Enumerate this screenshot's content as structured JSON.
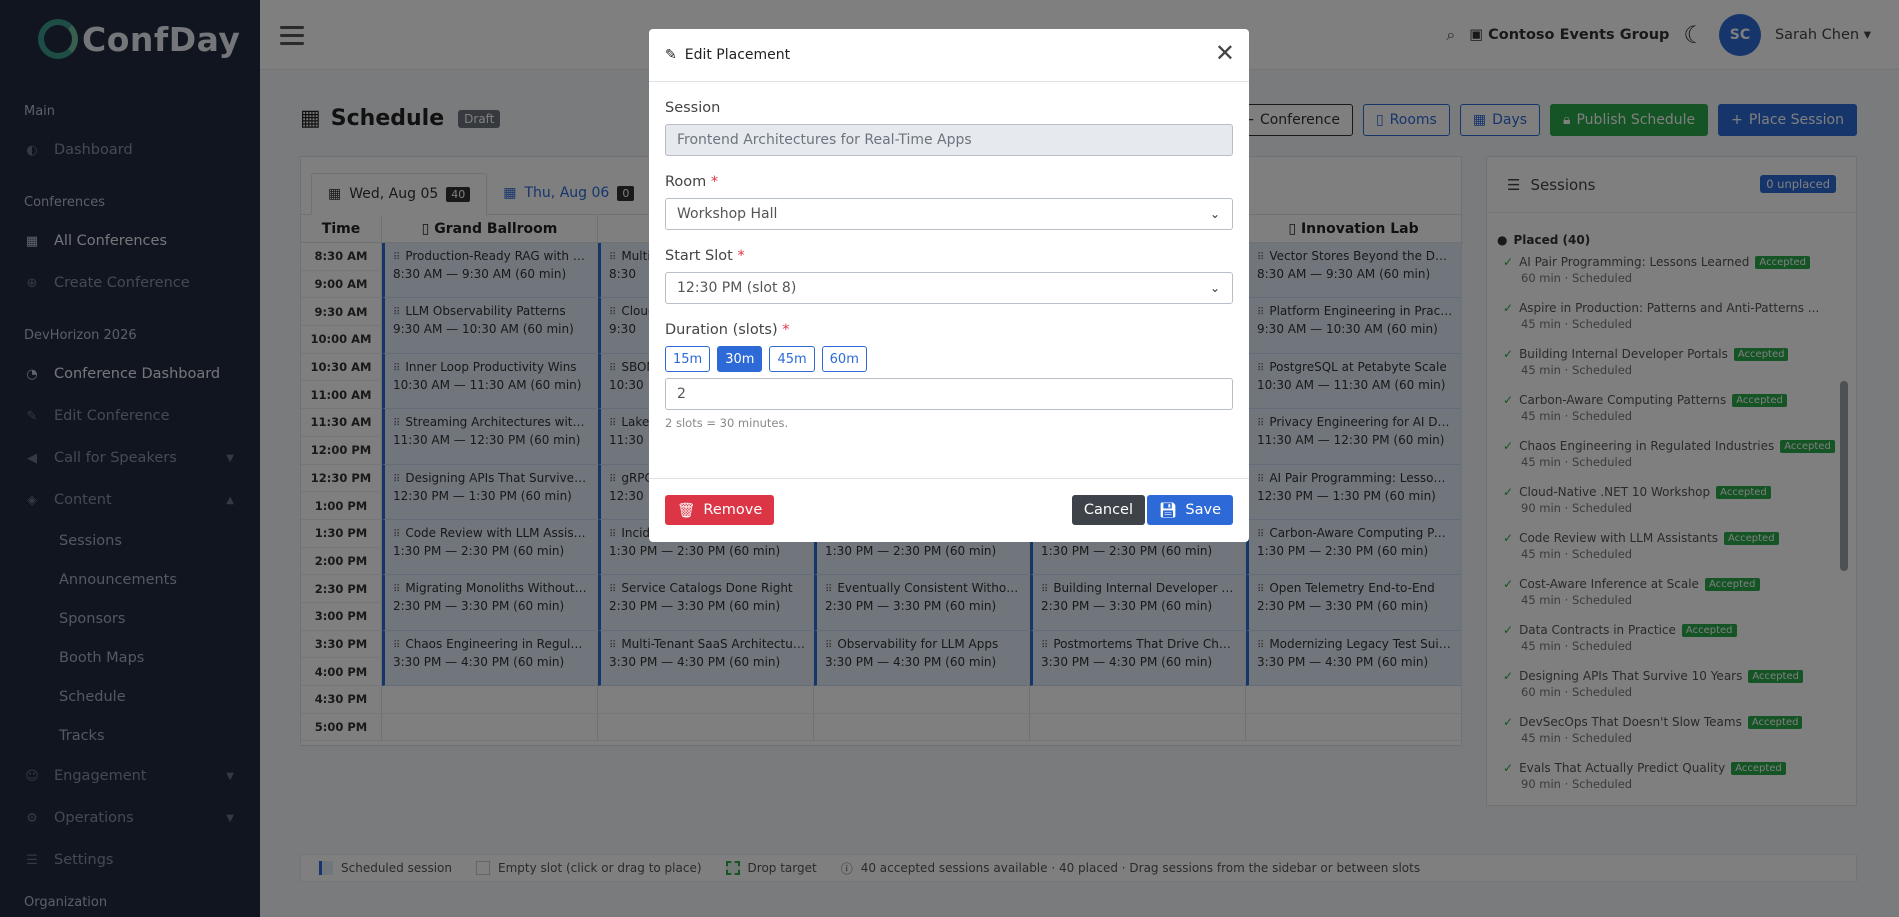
{
  "brand": {
    "name": "ConfDay"
  },
  "sidebar": {
    "sections": {
      "main": "Main",
      "conferences": "Conferences",
      "event": "DevHorizon 2026",
      "organization": "Organization"
    },
    "items": {
      "dashboard": "Dashboard",
      "all_conferences": "All Conferences",
      "create_conference": "Create Conference",
      "conference_dashboard": "Conference Dashboard",
      "edit_conference": "Edit Conference",
      "call_for_speakers": "Call for Speakers",
      "content": "Content",
      "engagement": "Engagement",
      "operations": "Operations",
      "settings": "Settings"
    },
    "content_sub": [
      "Sessions",
      "Announcements",
      "Sponsors",
      "Booth Maps",
      "Schedule",
      "Tracks"
    ]
  },
  "topbar": {
    "org": "Contoso Events Group",
    "avatar_initials": "SC",
    "user_name": "Sarah Chen"
  },
  "page": {
    "title": "Schedule",
    "status_badge": "Draft",
    "buttons": {
      "conference": "Conference",
      "rooms": "Rooms",
      "days": "Days",
      "publish": "Publish Schedule",
      "place": "Place Session"
    }
  },
  "day_tabs": [
    {
      "label": "Wed, Aug 05",
      "count": "40"
    },
    {
      "label": "Thu, Aug 06",
      "count": "0"
    }
  ],
  "grid": {
    "time_header": "Time",
    "rooms": [
      "Grand Ballroom",
      "",
      "",
      "",
      "Innovation Lab"
    ],
    "times": [
      "8:30 AM",
      "9:00 AM",
      "9:30 AM",
      "10:00 AM",
      "10:30 AM",
      "11:00 AM",
      "11:30 AM",
      "12:00 PM",
      "12:30 PM",
      "1:00 PM",
      "1:30 PM",
      "2:00 PM",
      "2:30 PM",
      "3:00 PM",
      "3:30 PM",
      "4:00 PM",
      "4:30 PM",
      "5:00 PM"
    ],
    "sessions": [
      {
        "col": 0,
        "row": 0,
        "title": "Production-Ready RAG with Ope...",
        "time": "8:30 AM — 9:30 AM (60 min)"
      },
      {
        "col": 0,
        "row": 2,
        "title": "LLM Observability Patterns",
        "time": "9:30 AM — 10:30 AM (60 min)"
      },
      {
        "col": 0,
        "row": 4,
        "title": "Inner Loop Productivity Wins",
        "time": "10:30 AM — 11:30 AM (60 min)"
      },
      {
        "col": 0,
        "row": 6,
        "title": "Streaming Architectures with Kaf...",
        "time": "11:30 AM — 12:30 PM (60 min)"
      },
      {
        "col": 0,
        "row": 8,
        "title": "Designing APIs That Survive 10 Ye...",
        "time": "12:30 PM — 1:30 PM (60 min)"
      },
      {
        "col": 0,
        "row": 10,
        "title": "Code Review with LLM Assistants",
        "time": "1:30 PM — 2:30 PM (60 min)"
      },
      {
        "col": 0,
        "row": 12,
        "title": "Migrating Monoliths Without Tears",
        "time": "2:30 PM — 3:30 PM (60 min)"
      },
      {
        "col": 0,
        "row": 14,
        "title": "Chaos Engineering in Regulated ...",
        "time": "3:30 PM — 4:30 PM (60 min)"
      },
      {
        "col": 1,
        "row": 0,
        "title": "Multi-",
        "time": "8:30"
      },
      {
        "col": 1,
        "row": 2,
        "title": "Cloud",
        "time": "9:30"
      },
      {
        "col": 1,
        "row": 4,
        "title": "SBOM",
        "time": "10:30"
      },
      {
        "col": 1,
        "row": 6,
        "title": "Lakeh",
        "time": "11:30"
      },
      {
        "col": 1,
        "row": 8,
        "title": "gRPC",
        "time": "12:30"
      },
      {
        "col": 1,
        "row": 10,
        "title": "Incid",
        "time": "1:30 PM — 2:30 PM (60 min)"
      },
      {
        "col": 1,
        "row": 12,
        "title": "Service Catalogs Done Right",
        "time": "2:30 PM — 3:30 PM (60 min)"
      },
      {
        "col": 1,
        "row": 14,
        "title": "Multi-Tenant SaaS Architectures",
        "time": "3:30 PM — 4:30 PM (60 min)"
      },
      {
        "col": 2,
        "row": 10,
        "title": "",
        "time": "1:30 PM — 2:30 PM (60 min)"
      },
      {
        "col": 2,
        "row": 12,
        "title": "Eventually Consistent Without th...",
        "time": "2:30 PM — 3:30 PM (60 min)"
      },
      {
        "col": 2,
        "row": 14,
        "title": "Observability for LLM Apps",
        "time": "3:30 PM — 4:30 PM (60 min)"
      },
      {
        "col": 3,
        "row": 10,
        "title": "",
        "time": "1:30 PM — 2:30 PM (60 min)"
      },
      {
        "col": 3,
        "row": 12,
        "title": "Building Internal Developer Porta...",
        "time": "2:30 PM — 3:30 PM (60 min)"
      },
      {
        "col": 3,
        "row": 14,
        "title": "Postmortems That Drive Change",
        "time": "3:30 PM — 4:30 PM (60 min)"
      },
      {
        "col": 4,
        "row": 0,
        "title": "Vector Stores Beyond the Demo",
        "time": "8:30 AM — 9:30 AM (60 min)"
      },
      {
        "col": 4,
        "row": 2,
        "title": "Platform Engineering in Practice",
        "time": "9:30 AM — 10:30 AM (60 min)"
      },
      {
        "col": 4,
        "row": 4,
        "title": "PostgreSQL at Petabyte Scale",
        "time": "10:30 AM — 11:30 AM (60 min)"
      },
      {
        "col": 4,
        "row": 6,
        "title": "Privacy Engineering for AI Datase...",
        "time": "11:30 AM — 12:30 PM (60 min)"
      },
      {
        "col": 4,
        "row": 8,
        "title": "AI Pair Programming: Lessons Le...",
        "time": "12:30 PM — 1:30 PM (60 min)"
      },
      {
        "col": 4,
        "row": 10,
        "title": "Carbon-Aware Computing Patte...",
        "time": "1:30 PM — 2:30 PM (60 min)"
      },
      {
        "col": 4,
        "row": 12,
        "title": "Open Telemetry End-to-End",
        "time": "2:30 PM — 3:30 PM (60 min)"
      },
      {
        "col": 4,
        "row": 14,
        "title": "Modernizing Legacy Test Suites",
        "time": "3:30 PM — 4:30 PM (60 min)"
      }
    ]
  },
  "sessions_panel": {
    "title": "Sessions",
    "unplaced_badge": "0 unplaced",
    "placed_header": "Placed (40)",
    "items": [
      {
        "title": "AI Pair Programming: Lessons Learned",
        "badge": "Accepted",
        "meta": "60 min · Scheduled"
      },
      {
        "title": "Aspire in Production: Patterns and Anti-Patterns ...",
        "badge": "",
        "meta": "45 min · Scheduled"
      },
      {
        "title": "Building Internal Developer Portals",
        "badge": "Accepted",
        "meta": "45 min · Scheduled"
      },
      {
        "title": "Carbon-Aware Computing Patterns",
        "badge": "Accepted",
        "meta": "45 min · Scheduled"
      },
      {
        "title": "Chaos Engineering in Regulated Industries",
        "badge": "Accepted",
        "meta": "45 min · Scheduled"
      },
      {
        "title": "Cloud-Native .NET 10 Workshop",
        "badge": "Accepted",
        "meta": "90 min · Scheduled"
      },
      {
        "title": "Code Review with LLM Assistants",
        "badge": "Accepted",
        "meta": "45 min · Scheduled"
      },
      {
        "title": "Cost-Aware Inference at Scale",
        "badge": "Accepted",
        "meta": "45 min · Scheduled"
      },
      {
        "title": "Data Contracts in Practice",
        "badge": "Accepted",
        "meta": "45 min · Scheduled"
      },
      {
        "title": "Designing APIs That Survive 10 Years",
        "badge": "Accepted",
        "meta": "60 min · Scheduled"
      },
      {
        "title": "DevSecOps That Doesn't Slow Teams",
        "badge": "Accepted",
        "meta": "45 min · Scheduled"
      },
      {
        "title": "Evals That Actually Predict Quality",
        "badge": "Accepted",
        "meta": "90 min · Scheduled"
      }
    ]
  },
  "legend": {
    "scheduled": "Scheduled session",
    "empty": "Empty slot (click or drag to place)",
    "drop": "Drop target",
    "info": "40 accepted sessions available · 40 placed · Drag sessions from the sidebar or between slots"
  },
  "modal": {
    "title": "Edit Placement",
    "session_label": "Session",
    "session_value": "Frontend Architectures for Real-Time Apps",
    "room_label": "Room",
    "room_value": "Workshop Hall",
    "start_label": "Start Slot",
    "start_value": "12:30 PM (slot 8)",
    "duration_label": "Duration (slots)",
    "duration_options": [
      "15m",
      "30m",
      "45m",
      "60m"
    ],
    "duration_selected": "30m",
    "duration_value": "2",
    "hint": "2 slots = 30 minutes.",
    "remove": "Remove",
    "cancel": "Cancel",
    "save": "Save"
  },
  "colors": {
    "primary": "#2d6ad7",
    "success": "#2aa84b",
    "danger": "#dc3545",
    "sidebar_bg": "#212a3e"
  }
}
